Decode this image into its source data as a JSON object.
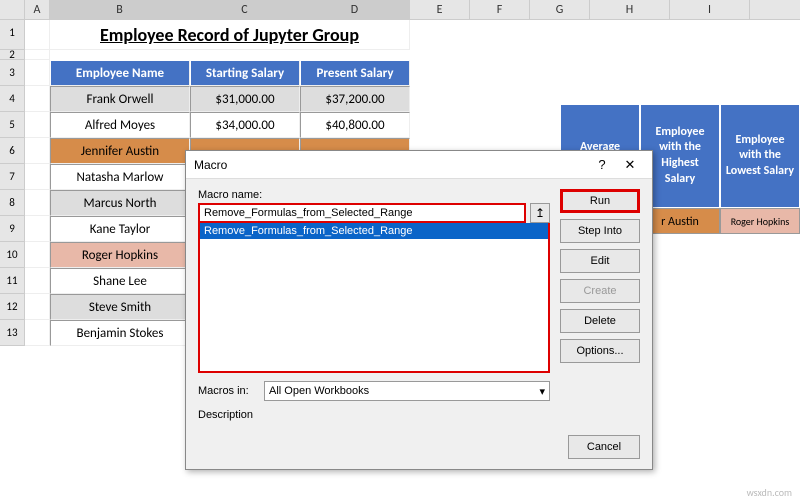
{
  "columns": [
    "A",
    "B",
    "C",
    "D",
    "E",
    "F",
    "G",
    "H",
    "I"
  ],
  "title": "Employee Record of Jupyter Group",
  "table": {
    "headers": [
      "Employee Name",
      "Starting Salary",
      "Present Salary"
    ],
    "rows": [
      {
        "name": "Frank Orwell",
        "start": "$31,000.00",
        "present": "$37,200.00",
        "style": "grey"
      },
      {
        "name": "Alfred Moyes",
        "start": "$34,000.00",
        "present": "$40,800.00",
        "style": "plain"
      },
      {
        "name": "Jennifer Austin",
        "start": "",
        "present": "",
        "style": "orange"
      },
      {
        "name": "Natasha Marlow",
        "start": "",
        "present": "",
        "style": "plain"
      },
      {
        "name": "Marcus North",
        "start": "",
        "present": "",
        "style": "grey"
      },
      {
        "name": "Kane Taylor",
        "start": "",
        "present": "",
        "style": "plain"
      },
      {
        "name": "Roger Hopkins",
        "start": "",
        "present": "",
        "style": "pink"
      },
      {
        "name": "Shane Lee",
        "start": "",
        "present": "",
        "style": "plain"
      },
      {
        "name": "Steve Smith",
        "start": "",
        "present": "",
        "style": "grey"
      },
      {
        "name": "Benjamin Stokes",
        "start": "",
        "present": "",
        "style": "plain"
      }
    ]
  },
  "side": {
    "cols": [
      {
        "header": "Average Salary",
        "value": "",
        "bg": "#d68c4a"
      },
      {
        "header": "Employee with the Highest Salary",
        "value": "r Austin",
        "bg": "#d68c4a"
      },
      {
        "header": "Employee with the Lowest Salary",
        "value": "Roger Hopkins",
        "bg": "#e8b8a8"
      }
    ]
  },
  "dialog": {
    "title": "Macro",
    "macro_name_label": "Macro name:",
    "macro_name_value": "Remove_Formulas_from_Selected_Range",
    "list_item": "Remove_Formulas_from_Selected_Range",
    "macros_in_label": "Macros in:",
    "macros_in_value": "All Open Workbooks",
    "description_label": "Description",
    "buttons": {
      "run": "Run",
      "step_into": "Step Into",
      "edit": "Edit",
      "create": "Create",
      "delete": "Delete",
      "options": "Options...",
      "cancel": "Cancel"
    }
  },
  "watermark": "wsxdn.com"
}
